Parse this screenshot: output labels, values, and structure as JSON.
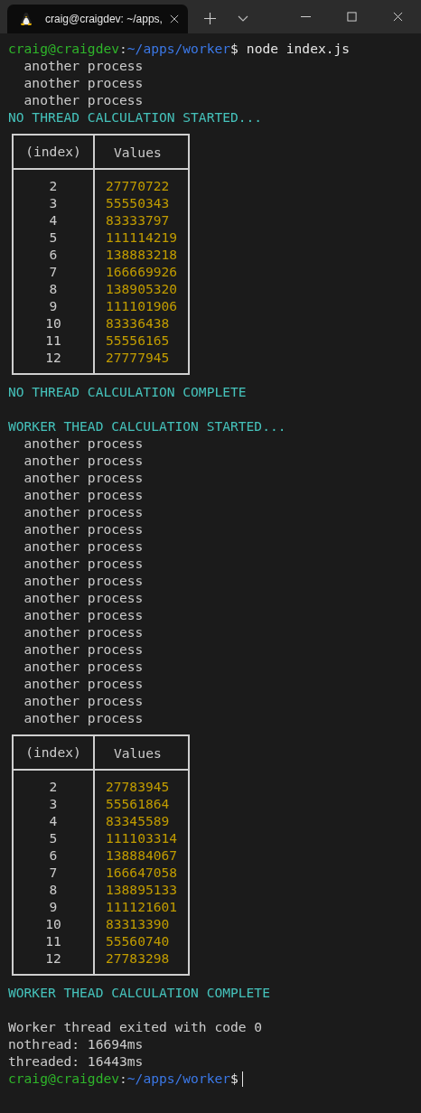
{
  "tab": {
    "title": "craig@craigdev: ~/apps,",
    "selected": true
  },
  "lines": [
    {
      "kind": "prompt",
      "user": "craig@craigdev",
      "sep": ":",
      "path": "~/apps/worker",
      "symbol": "$",
      "command": "node index.js",
      "cursor": false
    },
    {
      "kind": "text",
      "text": "  another process"
    },
    {
      "kind": "text",
      "text": "  another process"
    },
    {
      "kind": "text",
      "text": "  another process"
    },
    {
      "kind": "heading",
      "text": "NO THREAD CALCULATION STARTED..."
    },
    {
      "kind": "table",
      "columns": [
        "(index)",
        "Values"
      ],
      "rows": [
        {
          "index": "2",
          "value": "27770722"
        },
        {
          "index": "3",
          "value": "55550343"
        },
        {
          "index": "4",
          "value": "83333797"
        },
        {
          "index": "5",
          "value": "111114219"
        },
        {
          "index": "6",
          "value": "138883218"
        },
        {
          "index": "7",
          "value": "166669926"
        },
        {
          "index": "8",
          "value": "138905320"
        },
        {
          "index": "9",
          "value": "111101906"
        },
        {
          "index": "10",
          "value": "83336438"
        },
        {
          "index": "11",
          "value": "55556165"
        },
        {
          "index": "12",
          "value": "27777945"
        }
      ]
    },
    {
      "kind": "heading",
      "text": "NO THREAD CALCULATION COMPLETE"
    },
    {
      "kind": "blank"
    },
    {
      "kind": "heading",
      "text": "WORKER THEAD CALCULATION STARTED..."
    },
    {
      "kind": "text",
      "text": "  another process"
    },
    {
      "kind": "text",
      "text": "  another process"
    },
    {
      "kind": "text",
      "text": "  another process"
    },
    {
      "kind": "text",
      "text": "  another process"
    },
    {
      "kind": "text",
      "text": "  another process"
    },
    {
      "kind": "text",
      "text": "  another process"
    },
    {
      "kind": "text",
      "text": "  another process"
    },
    {
      "kind": "text",
      "text": "  another process"
    },
    {
      "kind": "text",
      "text": "  another process"
    },
    {
      "kind": "text",
      "text": "  another process"
    },
    {
      "kind": "text",
      "text": "  another process"
    },
    {
      "kind": "text",
      "text": "  another process"
    },
    {
      "kind": "text",
      "text": "  another process"
    },
    {
      "kind": "text",
      "text": "  another process"
    },
    {
      "kind": "text",
      "text": "  another process"
    },
    {
      "kind": "text",
      "text": "  another process"
    },
    {
      "kind": "text",
      "text": "  another process"
    },
    {
      "kind": "table",
      "columns": [
        "(index)",
        "Values"
      ],
      "rows": [
        {
          "index": "2",
          "value": "27783945"
        },
        {
          "index": "3",
          "value": "55561864"
        },
        {
          "index": "4",
          "value": "83345589"
        },
        {
          "index": "5",
          "value": "111103314"
        },
        {
          "index": "6",
          "value": "138884067"
        },
        {
          "index": "7",
          "value": "166647058"
        },
        {
          "index": "8",
          "value": "138895133"
        },
        {
          "index": "9",
          "value": "111121601"
        },
        {
          "index": "10",
          "value": "83313390"
        },
        {
          "index": "11",
          "value": "55560740"
        },
        {
          "index": "12",
          "value": "27783298"
        }
      ]
    },
    {
      "kind": "heading",
      "text": "WORKER THEAD CALCULATION COMPLETE"
    },
    {
      "kind": "blank"
    },
    {
      "kind": "text",
      "text": "Worker thread exited with code 0"
    },
    {
      "kind": "text",
      "text": "nothread: 16694ms"
    },
    {
      "kind": "text",
      "text": "threaded: 16443ms"
    },
    {
      "kind": "prompt",
      "user": "craig@craigdev",
      "sep": ":",
      "path": "~/apps/worker",
      "symbol": "$",
      "cursor": true
    }
  ]
}
